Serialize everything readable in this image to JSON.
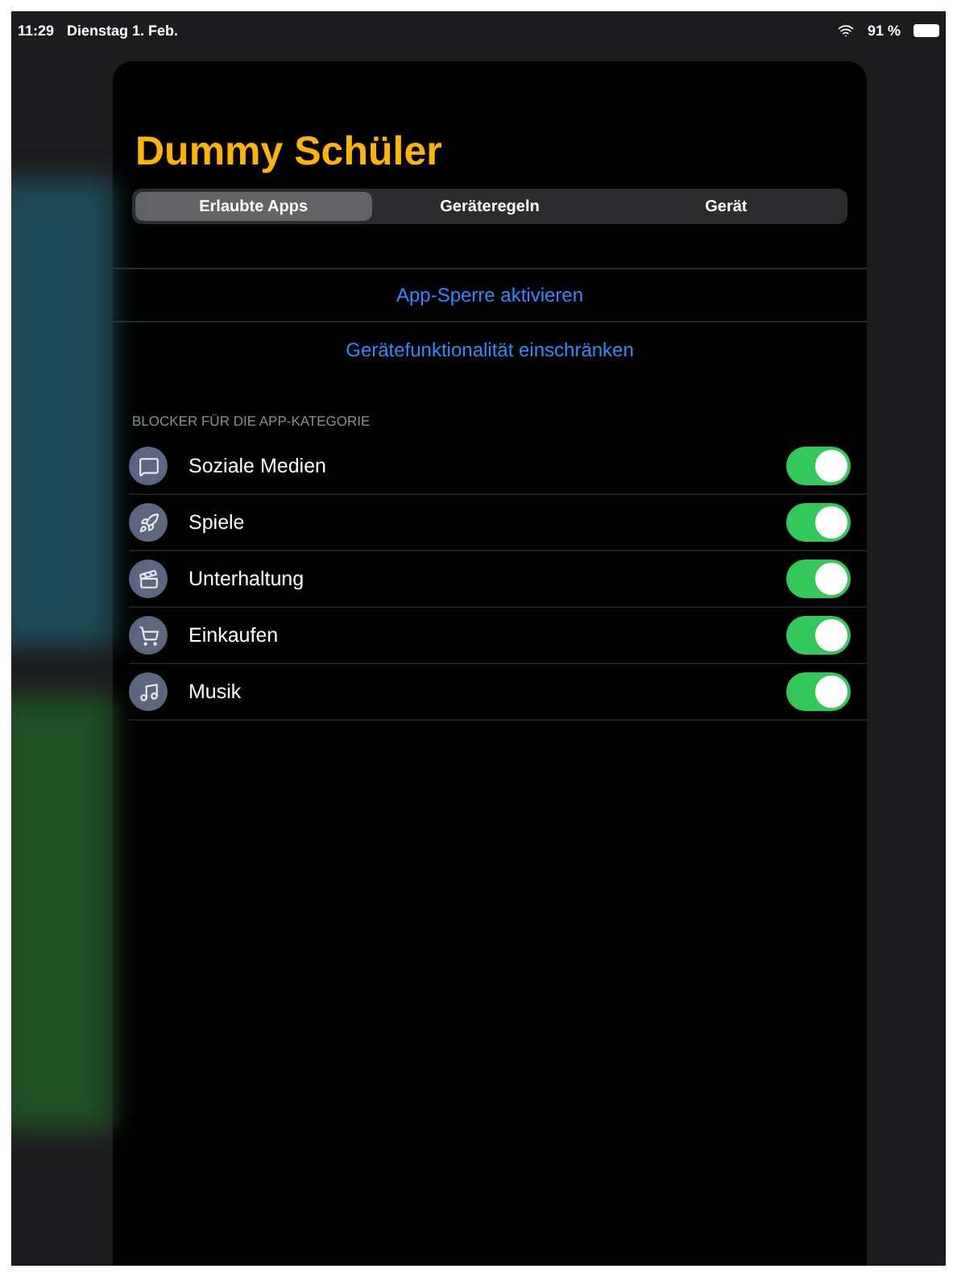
{
  "status_bar": {
    "time": "11:29",
    "date": "Dienstag 1. Feb.",
    "battery": "91 %"
  },
  "sheet": {
    "title": "Dummy Schüler",
    "tabs": [
      {
        "label": "Erlaubte Apps",
        "selected": true
      },
      {
        "label": "Geräteregeln",
        "selected": false
      },
      {
        "label": "Gerät",
        "selected": false
      }
    ],
    "actions": [
      "App-Sperre aktivieren",
      "Gerätefunktionalität einschränken"
    ],
    "section_header": "BLOCKER FÜR DIE APP-KATEGORIE",
    "categories": [
      {
        "kind": "social",
        "label": "Soziale Medien",
        "on": true
      },
      {
        "kind": "games",
        "label": "Spiele",
        "on": true
      },
      {
        "kind": "entertainment",
        "label": "Unterhaltung",
        "on": true
      },
      {
        "kind": "shopping",
        "label": "Einkaufen",
        "on": true
      },
      {
        "kind": "music",
        "label": "Musik",
        "on": true
      }
    ]
  }
}
